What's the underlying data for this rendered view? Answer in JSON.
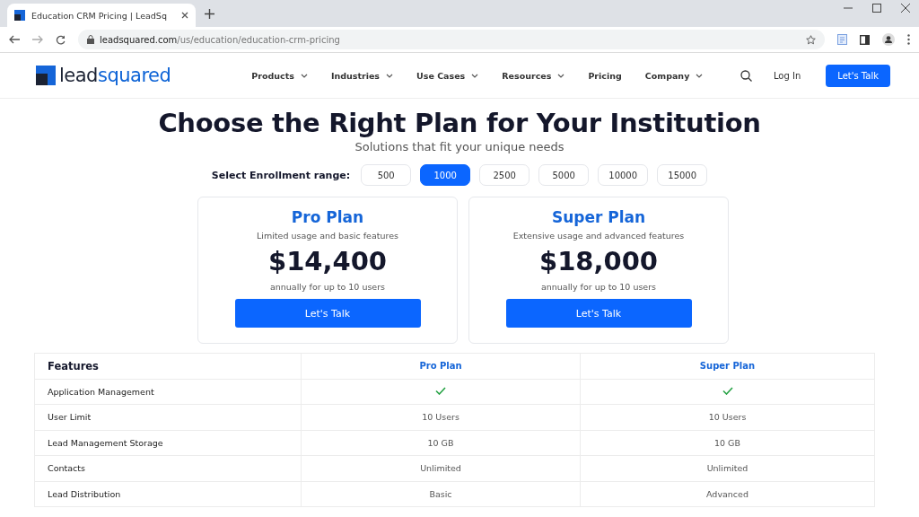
{
  "browser": {
    "tab_title": "Education CRM Pricing | LeadSq",
    "url_domain": "leadsquared.com",
    "url_path": "/us/education/education-crm-pricing"
  },
  "header": {
    "logo": {
      "part_1": "lead",
      "part_2": "squared"
    },
    "nav": [
      {
        "label": "Products",
        "dropdown": true
      },
      {
        "label": "Industries",
        "dropdown": true
      },
      {
        "label": "Use Cases",
        "dropdown": true
      },
      {
        "label": "Resources",
        "dropdown": true
      },
      {
        "label": "Pricing",
        "dropdown": false
      },
      {
        "label": "Company",
        "dropdown": true
      }
    ],
    "login": "Log In",
    "cta": "Let's Talk"
  },
  "title": "Choose the Right Plan for Your Institution",
  "subtitle": "Solutions that fit your unique needs",
  "range": {
    "label": "Select Enrollment range:",
    "options": [
      {
        "label": "500",
        "selected": false
      },
      {
        "label": "1000",
        "selected": true
      },
      {
        "label": "2500",
        "selected": false
      },
      {
        "label": "5000",
        "selected": false
      },
      {
        "label": "10000",
        "selected": false
      },
      {
        "label": "15000",
        "selected": false
      }
    ]
  },
  "plans": [
    {
      "name": "Pro Plan",
      "description": "Limited usage and basic features",
      "price": "$14,400",
      "note": "annually for up to 10 users",
      "button": "Let's Talk"
    },
    {
      "name": "Super Plan",
      "description": "Extensive usage and advanced features",
      "price": "$18,000",
      "note": "annually for up to 10 users",
      "button": "Let's Talk"
    }
  ],
  "table": {
    "columns": [
      "Features",
      "Pro Plan",
      "Super Plan"
    ],
    "rows": [
      {
        "cells": [
          {
            "kind": "text",
            "text": "Application Management"
          },
          {
            "kind": "check"
          },
          {
            "kind": "check"
          }
        ]
      },
      {
        "cells": [
          {
            "kind": "text",
            "text": "User Limit"
          },
          {
            "kind": "text",
            "text": "10 Users"
          },
          {
            "kind": "text",
            "text": "10 Users"
          }
        ]
      },
      {
        "cells": [
          {
            "kind": "text",
            "text": "Lead Management Storage"
          },
          {
            "kind": "text",
            "text": "10 GB"
          },
          {
            "kind": "text",
            "text": "10 GB"
          }
        ]
      },
      {
        "cells": [
          {
            "kind": "text",
            "text": "Contacts"
          },
          {
            "kind": "text",
            "text": "Unlimited"
          },
          {
            "kind": "text",
            "text": "Unlimited"
          }
        ]
      },
      {
        "cells": [
          {
            "kind": "text",
            "text": "Lead Distribution"
          },
          {
            "kind": "text",
            "text": "Basic"
          },
          {
            "kind": "text",
            "text": "Advanced"
          }
        ]
      }
    ]
  }
}
